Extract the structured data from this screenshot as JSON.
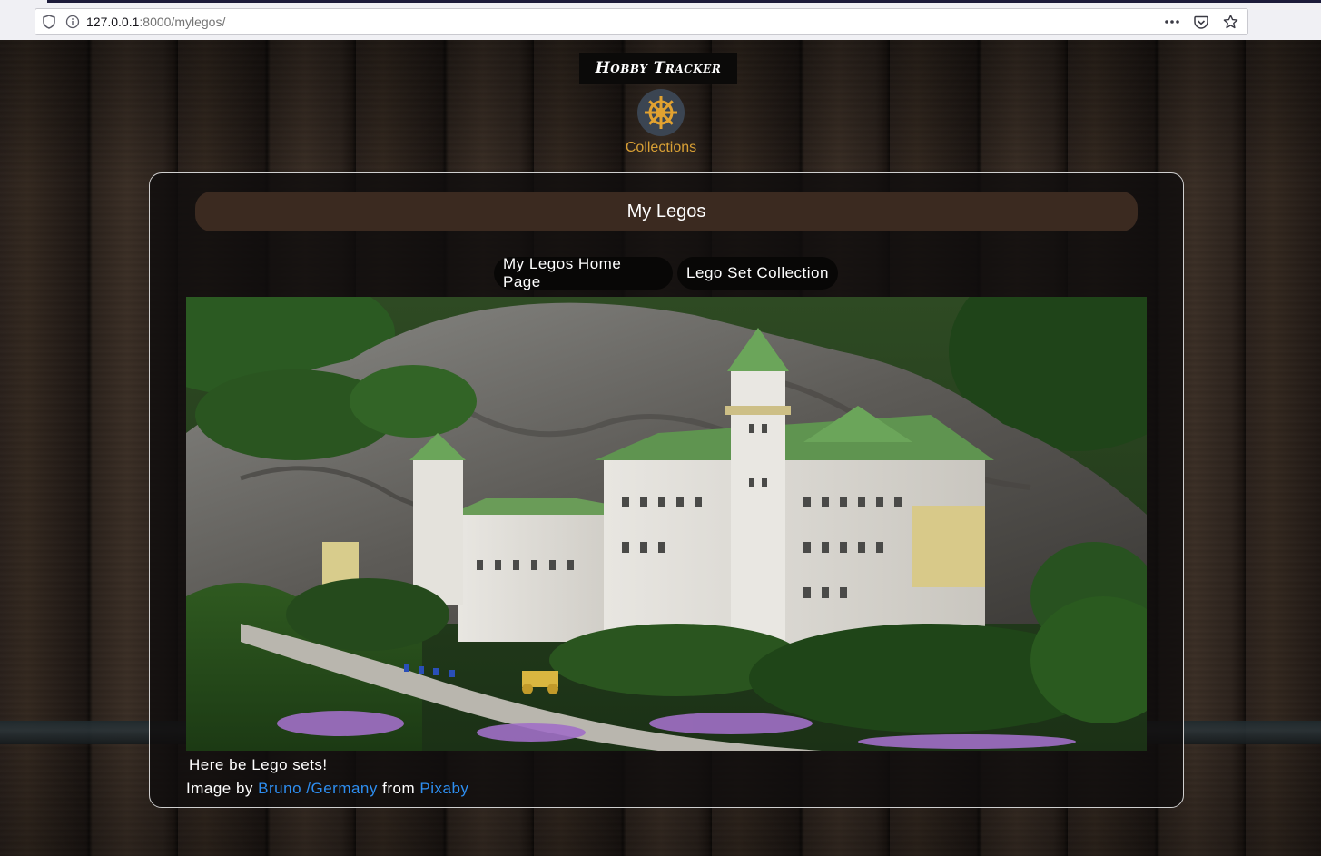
{
  "browser": {
    "url_host": "127.0.0.1",
    "url_path": ":8000/mylegos/",
    "icons": [
      "shield-icon",
      "info-icon",
      "more-icon",
      "pocket-icon",
      "star-icon"
    ]
  },
  "header": {
    "brand": "Hobby Tracker",
    "nav": {
      "collections_label": "Collections",
      "icon": "ship-wheel-icon"
    }
  },
  "main": {
    "title": "My Legos",
    "buttons": {
      "home_label": "My Legos Home Page",
      "sets_label": "Lego Set Collection"
    },
    "caption": "Here be Lego sets!",
    "credit": {
      "prefix": "Image by",
      "author": "Bruno /Germany",
      "middle": "from",
      "source": "Pixaby"
    }
  },
  "colors": {
    "accent": "#d9a035",
    "title_bar": "#3b2a20",
    "link": "#2e8ef0"
  }
}
